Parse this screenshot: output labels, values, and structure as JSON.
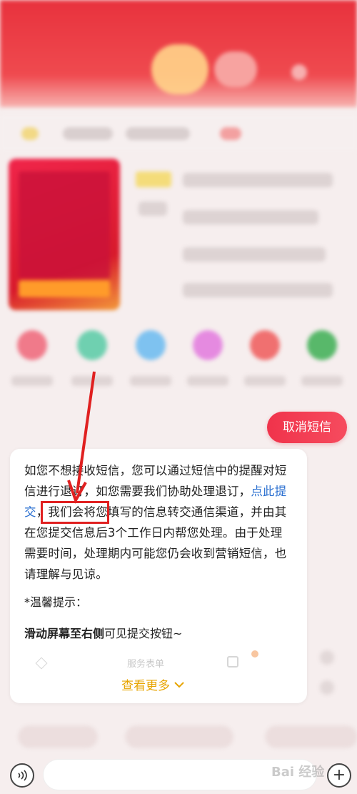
{
  "colors": {
    "brand_red": "#f0334b",
    "link_blue": "#2a6fd0",
    "more_gold": "#e7a400",
    "annotation_red": "#e02020"
  },
  "actions": {
    "cancel_sms_label": "取消短信"
  },
  "reply": {
    "text_before": "如您不想接收短信，您可以通过短信中的提醒对短信进行退订，如您需要我们协助处理退订，",
    "submit_link": "点此提交",
    "text_after": "，我们会将您填写的信息转交通信渠道，并由其在您提交信息后3个工作日内帮您处理。由于处理需要时间，处理期内可能您仍会收到营销短信，也请理解与见谅。",
    "tip_title": "*温馨提示：",
    "tip_bold": "滑动屏幕至右侧",
    "tip_rest": "可见提交按钮~",
    "faded_label": "服务表单",
    "more_label": "查看更多",
    "more_icon": "chevron-down-icon"
  },
  "composer": {
    "voice_icon": "voice-icon",
    "plus_icon": "plus-icon",
    "watermark": "Bai 经验"
  }
}
